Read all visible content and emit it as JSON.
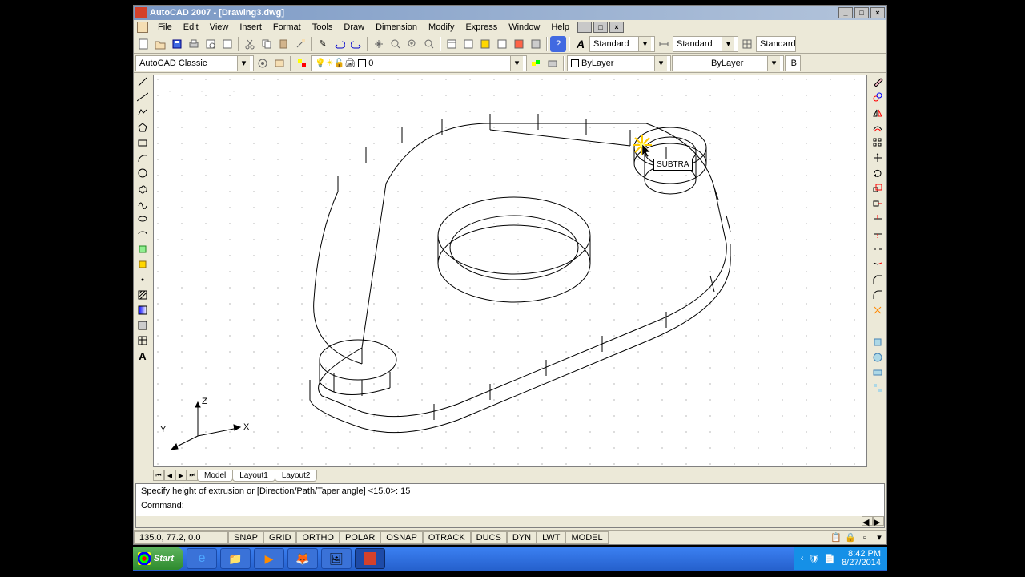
{
  "title": "AutoCAD 2007 - [Drawing3.dwg]",
  "menu": [
    "File",
    "Edit",
    "View",
    "Insert",
    "Format",
    "Tools",
    "Draw",
    "Dimension",
    "Modify",
    "Express",
    "Window",
    "Help"
  ],
  "workspace": "AutoCAD Classic",
  "textStyle1": "Standard",
  "textStyle2": "Standard",
  "textStyle3": "Standard",
  "layerName": "0",
  "linetype": "ByLayer",
  "lineweight": "ByLayer",
  "coords": "135.0, 77.2, 0.0",
  "statusButtons": [
    "SNAP",
    "GRID",
    "ORTHO",
    "POLAR",
    "OSNAP",
    "OTRACK",
    "DUCS",
    "DYN",
    "LWT",
    "MODEL"
  ],
  "tabs": [
    "Model",
    "Layout1",
    "Layout2"
  ],
  "cmd": {
    "history": "Specify height of extrusion or [Direction/Path/Taper angle] <15.0>: 15",
    "prompt": "Command:"
  },
  "tooltip": "SUBTRA",
  "ucs": {
    "x": "X",
    "y": "Y",
    "z": "Z"
  },
  "tray": {
    "time": "8:42 PM",
    "date": "8/27/2014"
  },
  "start": "Start"
}
